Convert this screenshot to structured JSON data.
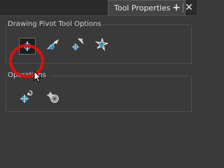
{
  "tab": {
    "title": "Tool Properties",
    "add_icon": "plus-icon",
    "close_icon": "close-icon"
  },
  "options_group": {
    "title": "Drawing Pivot Tool Options",
    "tools": [
      {
        "name": "drawing-pivot-mode-icon",
        "selected": true
      },
      {
        "name": "pivot-animation-tool-icon",
        "selected": false
      },
      {
        "name": "pivot-transform-tool-icon",
        "selected": false
      },
      {
        "name": "pivot-spark-tool-icon",
        "selected": false
      }
    ]
  },
  "operations_group": {
    "title": "Operations",
    "buttons": [
      {
        "name": "reset-pivot-icon"
      },
      {
        "name": "pivot-settings-icon"
      }
    ]
  },
  "colors": {
    "accent": "#38b9e0",
    "highlight": "#e00d0d",
    "panel": "#3a3a3a"
  }
}
